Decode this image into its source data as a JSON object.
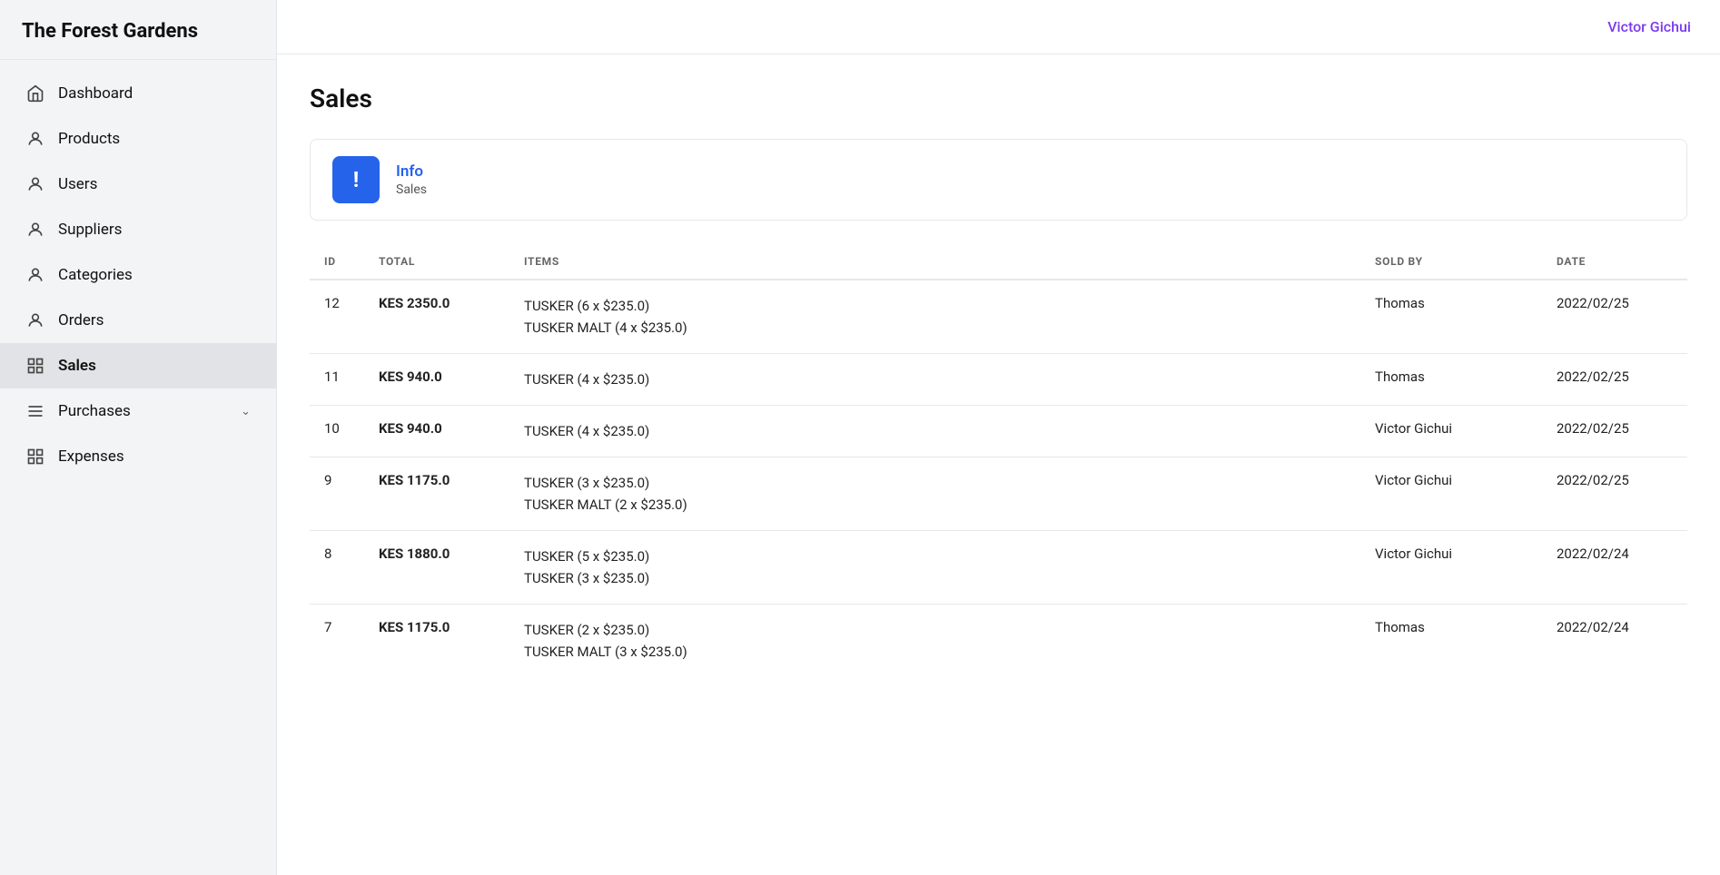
{
  "app": {
    "title": "The Forest Gardens"
  },
  "header": {
    "user": "Victor Gichui"
  },
  "sidebar": {
    "items": [
      {
        "id": "dashboard",
        "label": "Dashboard",
        "icon": "home"
      },
      {
        "id": "products",
        "label": "Products",
        "icon": "person"
      },
      {
        "id": "users",
        "label": "Users",
        "icon": "person"
      },
      {
        "id": "suppliers",
        "label": "Suppliers",
        "icon": "person"
      },
      {
        "id": "categories",
        "label": "Categories",
        "icon": "person"
      },
      {
        "id": "orders",
        "label": "Orders",
        "icon": "person"
      },
      {
        "id": "sales",
        "label": "Sales",
        "icon": "table",
        "active": true
      },
      {
        "id": "purchases",
        "label": "Purchases",
        "icon": "list",
        "chevron": true
      },
      {
        "id": "expenses",
        "label": "Expenses",
        "icon": "table"
      }
    ]
  },
  "page": {
    "title": "Sales"
  },
  "info_card": {
    "title": "Info",
    "subtitle": "Sales"
  },
  "table": {
    "columns": [
      "ID",
      "TOTAL",
      "ITEMS",
      "SOLD BY",
      "DATE"
    ],
    "rows": [
      {
        "id": "12",
        "total": "KES 2350.0",
        "items": [
          "TUSKER (6 x $235.0)",
          "TUSKER MALT (4 x $235.0)"
        ],
        "sold_by": "Thomas",
        "date": "2022/02/25"
      },
      {
        "id": "11",
        "total": "KES 940.0",
        "items": [
          "TUSKER (4 x $235.0)"
        ],
        "sold_by": "Thomas",
        "date": "2022/02/25"
      },
      {
        "id": "10",
        "total": "KES 940.0",
        "items": [
          "TUSKER (4 x $235.0)"
        ],
        "sold_by": "Victor Gichui",
        "date": "2022/02/25"
      },
      {
        "id": "9",
        "total": "KES 1175.0",
        "items": [
          "TUSKER (3 x $235.0)",
          "TUSKER MALT (2 x $235.0)"
        ],
        "sold_by": "Victor Gichui",
        "date": "2022/02/25"
      },
      {
        "id": "8",
        "total": "KES 1880.0",
        "items": [
          "TUSKER (5 x $235.0)",
          "TUSKER (3 x $235.0)"
        ],
        "sold_by": "Victor Gichui",
        "date": "2022/02/24"
      },
      {
        "id": "7",
        "total": "KES 1175.0",
        "items": [
          "TUSKER (2 x $235.0)",
          "TUSKER MALT (3 x $235.0)"
        ],
        "sold_by": "Thomas",
        "date": "2022/02/24"
      }
    ]
  }
}
